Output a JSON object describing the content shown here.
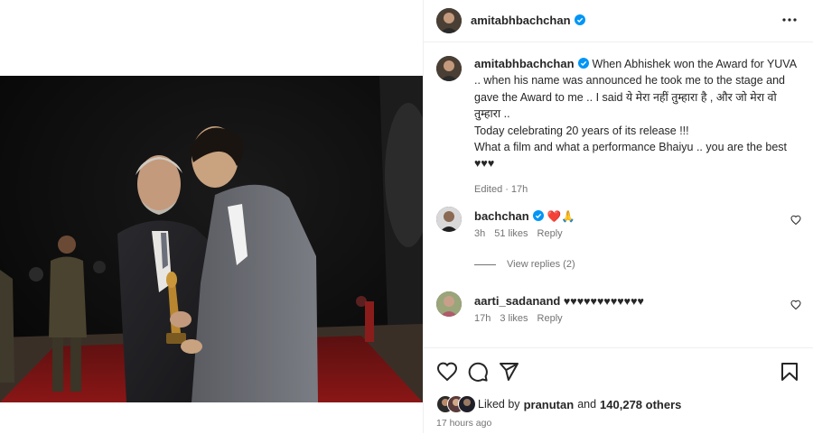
{
  "header": {
    "username": "amitabhbachchan",
    "verified_icon": "verified-badge-icon",
    "more_icon": "more-options-icon"
  },
  "caption": {
    "username": "amitabhbachchan",
    "line1": "When Abhishek won the Award for YUVA .. when his name was announced he took me to the stage and gave the Award to me .. I said ये मेरा नहीं तुम्हारा है , और जो मेरा वो तुम्हारा ..",
    "line2": "Today celebrating 20 years of its release !!!",
    "line3": "What a film and what a performance Bhaiyu .. you are the best ♥♥♥",
    "edited": "Edited",
    "time": "17h"
  },
  "comments": [
    {
      "username": "bachchan",
      "text": "❤️🙏",
      "time": "3h",
      "likes": "51 likes",
      "reply": "Reply"
    },
    {
      "username": "aarti_sadanand",
      "text": "♥♥♥♥♥♥♥♥♥♥♥♥",
      "time": "17h",
      "likes": "3 likes",
      "reply": "Reply"
    }
  ],
  "view_replies": "View replies (2)",
  "likes": {
    "prefix": "Liked by",
    "user": "pranutan",
    "and": "and",
    "count": "140,278 others"
  },
  "posted": "17 hours ago",
  "colors": {
    "verified": "#0095f6",
    "text": "#262626",
    "muted": "#737373",
    "border": "#efefef"
  }
}
